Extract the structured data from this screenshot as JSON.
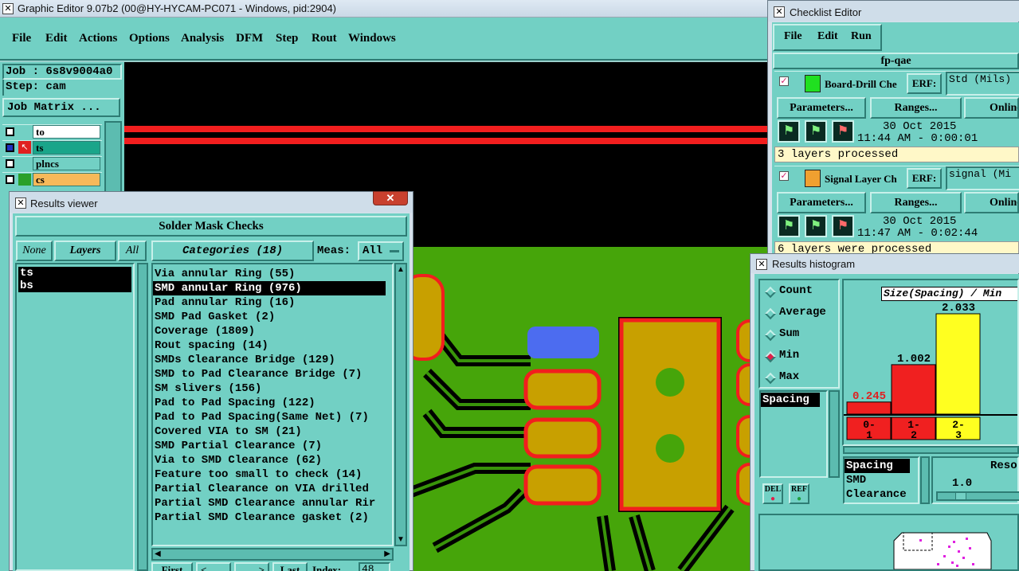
{
  "graphic_editor": {
    "title": "Graphic Editor 9.07b2 (00@HY-HYCAM-PC071 - Windows, pid:2904)",
    "menu": [
      "File",
      "Edit",
      "Actions",
      "Options",
      "Analysis",
      "DFM",
      "Step",
      "Rout",
      "Windows"
    ],
    "job": "Job : 6s8v9004a0",
    "step": "Step: cam",
    "job_matrix": "Job Matrix ...",
    "layers": [
      {
        "name": "to",
        "color": "#ffffff"
      },
      {
        "name": "ts",
        "color": "#1aa58a"
      },
      {
        "name": "plncs",
        "color": "#72d0c4"
      },
      {
        "name": "cs",
        "color": "#f7b95a"
      }
    ]
  },
  "results_viewer": {
    "title": "Results viewer",
    "header": "Solder Mask Checks",
    "none_btn": "None",
    "layers_btn": "Layers",
    "all_btn": "All",
    "layer_items": [
      "ts",
      "bs"
    ],
    "categories_btn": "Categories (18)",
    "meas_label": "Meas:",
    "meas_value": "All",
    "categories": [
      "Via annular Ring (55)",
      "SMD annular Ring (976)",
      "Pad annular Ring (16)",
      "SMD Pad Gasket (2)",
      "Coverage (1809)",
      "Rout spacing (14)",
      "SMDs Clearance Bridge (129)",
      "SMD to Pad Clearance Bridge (7)",
      "SM slivers (156)",
      "Pad to Pad Spacing (122)",
      "Pad to Pad Spacing(Same Net) (7)",
      "Covered VIA to SM (21)",
      "SMD Partial Clearance (7)",
      "Via to SMD Clearance (62)",
      "Feature too small to check (14)",
      "Partial Clearance on VIA drilled",
      "Partial SMD Clearance annular Rir",
      "Partial SMD Clearance gasket (2)"
    ],
    "selected_index": 1,
    "bottom": {
      "first": "First",
      "prev": "<",
      "next": ">",
      "last": "Last",
      "index_label": "Index:",
      "index_value": "48"
    }
  },
  "checklist_editor": {
    "title": "Checklist Editor",
    "menu": [
      "File",
      "Edit",
      "Run"
    ],
    "checklist_name": "fp-qae",
    "checks": [
      {
        "name": "Board-Drill Che",
        "erf": "ERF:",
        "erf_value": "Std (Mils)",
        "params": "Parameters...",
        "ranges": "Ranges...",
        "online": "Online",
        "date": "30 Oct 2015",
        "time": "11:44 AM - 0:00:01",
        "status": "3 layers processed"
      },
      {
        "name": "Signal Layer Ch",
        "erf": "ERF:",
        "erf_value": "signal (Mi",
        "params": "Parameters...",
        "ranges": "Ranges...",
        "online": "Online",
        "date": "30 Oct 2015",
        "time": "11:47 AM - 0:02:44",
        "status": "6 layers were processed"
      }
    ]
  },
  "results_histogram": {
    "title": "Results histogram",
    "modes": [
      "Count",
      "Average",
      "Sum",
      "Min",
      "Max"
    ],
    "selected_mode": "Min",
    "list1": [
      "Spacing"
    ],
    "chart_title": "Size(Spacing) / Min",
    "list2": [
      "Spacing",
      "SMD",
      "Clearance"
    ],
    "reso_label": "Reso",
    "reso_value": "1.0",
    "del_btn": "DEL",
    "ref_btn": "REF"
  },
  "chart_data": {
    "type": "bar",
    "categories": [
      "0-1",
      "1-2",
      "2-3"
    ],
    "values": [
      0.245,
      1.002,
      2.033
    ],
    "value_labels": [
      "0.245",
      "1.002",
      "2.033"
    ],
    "colors": [
      "#f02020",
      "#f02020",
      "#ffff20"
    ],
    "title": "Size(Spacing) / Min"
  }
}
